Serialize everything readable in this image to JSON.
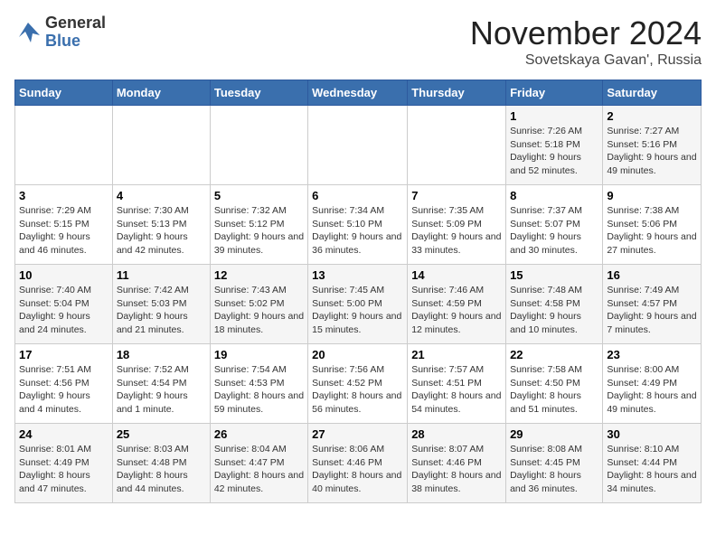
{
  "logo": {
    "general": "General",
    "blue": "Blue"
  },
  "title": "November 2024",
  "location": "Sovetskaya Gavan', Russia",
  "days_of_week": [
    "Sunday",
    "Monday",
    "Tuesday",
    "Wednesday",
    "Thursday",
    "Friday",
    "Saturday"
  ],
  "weeks": [
    [
      {
        "day": "",
        "info": ""
      },
      {
        "day": "",
        "info": ""
      },
      {
        "day": "",
        "info": ""
      },
      {
        "day": "",
        "info": ""
      },
      {
        "day": "",
        "info": ""
      },
      {
        "day": "1",
        "info": "Sunrise: 7:26 AM\nSunset: 5:18 PM\nDaylight: 9 hours and 52 minutes."
      },
      {
        "day": "2",
        "info": "Sunrise: 7:27 AM\nSunset: 5:16 PM\nDaylight: 9 hours and 49 minutes."
      }
    ],
    [
      {
        "day": "3",
        "info": "Sunrise: 7:29 AM\nSunset: 5:15 PM\nDaylight: 9 hours and 46 minutes."
      },
      {
        "day": "4",
        "info": "Sunrise: 7:30 AM\nSunset: 5:13 PM\nDaylight: 9 hours and 42 minutes."
      },
      {
        "day": "5",
        "info": "Sunrise: 7:32 AM\nSunset: 5:12 PM\nDaylight: 9 hours and 39 minutes."
      },
      {
        "day": "6",
        "info": "Sunrise: 7:34 AM\nSunset: 5:10 PM\nDaylight: 9 hours and 36 minutes."
      },
      {
        "day": "7",
        "info": "Sunrise: 7:35 AM\nSunset: 5:09 PM\nDaylight: 9 hours and 33 minutes."
      },
      {
        "day": "8",
        "info": "Sunrise: 7:37 AM\nSunset: 5:07 PM\nDaylight: 9 hours and 30 minutes."
      },
      {
        "day": "9",
        "info": "Sunrise: 7:38 AM\nSunset: 5:06 PM\nDaylight: 9 hours and 27 minutes."
      }
    ],
    [
      {
        "day": "10",
        "info": "Sunrise: 7:40 AM\nSunset: 5:04 PM\nDaylight: 9 hours and 24 minutes."
      },
      {
        "day": "11",
        "info": "Sunrise: 7:42 AM\nSunset: 5:03 PM\nDaylight: 9 hours and 21 minutes."
      },
      {
        "day": "12",
        "info": "Sunrise: 7:43 AM\nSunset: 5:02 PM\nDaylight: 9 hours and 18 minutes."
      },
      {
        "day": "13",
        "info": "Sunrise: 7:45 AM\nSunset: 5:00 PM\nDaylight: 9 hours and 15 minutes."
      },
      {
        "day": "14",
        "info": "Sunrise: 7:46 AM\nSunset: 4:59 PM\nDaylight: 9 hours and 12 minutes."
      },
      {
        "day": "15",
        "info": "Sunrise: 7:48 AM\nSunset: 4:58 PM\nDaylight: 9 hours and 10 minutes."
      },
      {
        "day": "16",
        "info": "Sunrise: 7:49 AM\nSunset: 4:57 PM\nDaylight: 9 hours and 7 minutes."
      }
    ],
    [
      {
        "day": "17",
        "info": "Sunrise: 7:51 AM\nSunset: 4:56 PM\nDaylight: 9 hours and 4 minutes."
      },
      {
        "day": "18",
        "info": "Sunrise: 7:52 AM\nSunset: 4:54 PM\nDaylight: 9 hours and 1 minute."
      },
      {
        "day": "19",
        "info": "Sunrise: 7:54 AM\nSunset: 4:53 PM\nDaylight: 8 hours and 59 minutes."
      },
      {
        "day": "20",
        "info": "Sunrise: 7:56 AM\nSunset: 4:52 PM\nDaylight: 8 hours and 56 minutes."
      },
      {
        "day": "21",
        "info": "Sunrise: 7:57 AM\nSunset: 4:51 PM\nDaylight: 8 hours and 54 minutes."
      },
      {
        "day": "22",
        "info": "Sunrise: 7:58 AM\nSunset: 4:50 PM\nDaylight: 8 hours and 51 minutes."
      },
      {
        "day": "23",
        "info": "Sunrise: 8:00 AM\nSunset: 4:49 PM\nDaylight: 8 hours and 49 minutes."
      }
    ],
    [
      {
        "day": "24",
        "info": "Sunrise: 8:01 AM\nSunset: 4:49 PM\nDaylight: 8 hours and 47 minutes."
      },
      {
        "day": "25",
        "info": "Sunrise: 8:03 AM\nSunset: 4:48 PM\nDaylight: 8 hours and 44 minutes."
      },
      {
        "day": "26",
        "info": "Sunrise: 8:04 AM\nSunset: 4:47 PM\nDaylight: 8 hours and 42 minutes."
      },
      {
        "day": "27",
        "info": "Sunrise: 8:06 AM\nSunset: 4:46 PM\nDaylight: 8 hours and 40 minutes."
      },
      {
        "day": "28",
        "info": "Sunrise: 8:07 AM\nSunset: 4:46 PM\nDaylight: 8 hours and 38 minutes."
      },
      {
        "day": "29",
        "info": "Sunrise: 8:08 AM\nSunset: 4:45 PM\nDaylight: 8 hours and 36 minutes."
      },
      {
        "day": "30",
        "info": "Sunrise: 8:10 AM\nSunset: 4:44 PM\nDaylight: 8 hours and 34 minutes."
      }
    ]
  ]
}
